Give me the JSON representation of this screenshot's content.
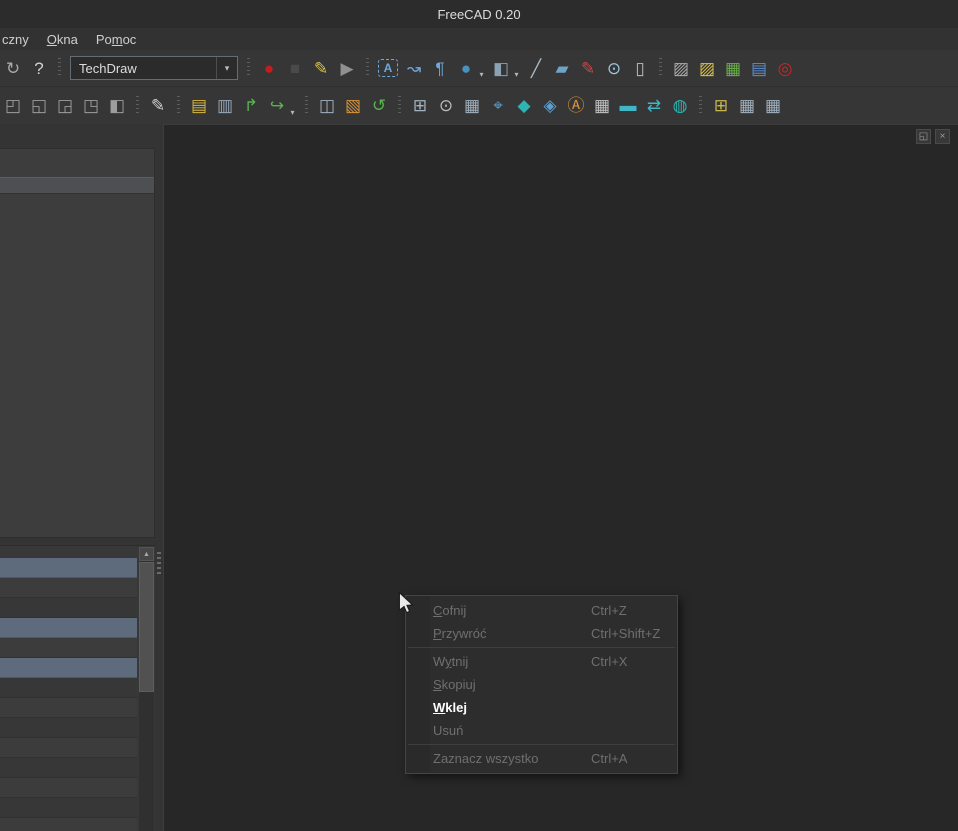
{
  "window": {
    "title": "FreeCAD 0.20"
  },
  "menubar": {
    "items": [
      {
        "pre": "czny",
        "mn": "",
        "post": ""
      },
      {
        "pre": "",
        "mn": "O",
        "post": "kna"
      },
      {
        "pre": "Po",
        "mn": "m",
        "post": "oc"
      }
    ]
  },
  "workbench": {
    "value": "TechDraw",
    "caret": "▾"
  },
  "toolbar1": {
    "nav": [
      {
        "name": "refresh",
        "glyph": "↻",
        "color": "#a9a9a9"
      },
      {
        "name": "whats-this",
        "glyph": "?",
        "color": "#d2d2d2"
      }
    ],
    "macro": [
      {
        "name": "macro-record",
        "glyph": "●",
        "color": "#c41d1d"
      },
      {
        "name": "macro-stop",
        "glyph": "■",
        "color": "#4a4a4a"
      },
      {
        "name": "macro-edit",
        "glyph": "✎",
        "color": "#d9c14d"
      },
      {
        "name": "macro-execute",
        "glyph": "▶",
        "color": "#909090"
      }
    ],
    "annotation": [
      {
        "name": "annotation",
        "glyph": "A",
        "color": "#6fa8dc"
      },
      {
        "name": "leader-line",
        "glyph": "↝",
        "color": "#6fa8dc"
      },
      {
        "name": "rich-text",
        "glyph": "¶",
        "color": "#6fa8dc"
      },
      {
        "name": "center-line",
        "glyph": "●",
        "color": "#4a90c2",
        "caret": "▾"
      },
      {
        "name": "cosmetic-object",
        "glyph": "◧",
        "color": "#8ba1b5",
        "caret": "▾"
      },
      {
        "name": "line-decor",
        "glyph": "╱",
        "color": "#a9bcc9"
      },
      {
        "name": "eraser",
        "glyph": "▰",
        "color": "#6fa3c7"
      },
      {
        "name": "red-pen",
        "glyph": "✎",
        "color": "#c94848"
      },
      {
        "name": "visibility-eye",
        "glyph": "⊙",
        "color": "#9ec7e0"
      },
      {
        "name": "column",
        "glyph": "▯",
        "color": "#bdbdbd"
      }
    ],
    "hatch": [
      {
        "name": "hatch-face",
        "glyph": "▨",
        "color": "#ababab"
      },
      {
        "name": "geometric-hatch",
        "glyph": "▨",
        "color": "#d9c14d"
      },
      {
        "name": "insert-symbol",
        "glyph": "▦",
        "color": "#6ab04c"
      },
      {
        "name": "insert-image",
        "glyph": "▤",
        "color": "#5a8fd0"
      },
      {
        "name": "toggle-frames",
        "glyph": "◎",
        "color": "#cc2424"
      }
    ]
  },
  "toolbar2": {
    "views": [
      {
        "name": "view-cube-1",
        "glyph": "◰",
        "color": "#9d9d9d"
      },
      {
        "name": "view-cube-2",
        "glyph": "◱",
        "color": "#9d9d9d"
      },
      {
        "name": "view-cube-3",
        "glyph": "◲",
        "color": "#9d9d9d"
      },
      {
        "name": "view-cube-4",
        "glyph": "◳",
        "color": "#9d9d9d"
      },
      {
        "name": "view-cube-5",
        "glyph": "◧",
        "color": "#9d9d9d"
      }
    ],
    "stylus": [
      {
        "name": "stylus",
        "glyph": "✎",
        "color": "#cfcfcf"
      }
    ],
    "pages": [
      {
        "name": "new-default-page",
        "glyph": "▤",
        "color": "#d9b83c"
      },
      {
        "name": "new-page-template",
        "glyph": "▥",
        "color": "#95a9bb"
      },
      {
        "name": "redraw-page",
        "glyph": "↱",
        "color": "#57b34f"
      },
      {
        "name": "export-page",
        "glyph": "↪",
        "color": "#57b34f",
        "caret": "▾"
      }
    ],
    "update": [
      {
        "name": "insert-view",
        "glyph": "◫",
        "color": "#a2b2c0"
      },
      {
        "name": "insert-active-view",
        "glyph": "▧",
        "color": "#d9933c"
      },
      {
        "name": "update-views",
        "glyph": "↺",
        "color": "#57b34f"
      }
    ],
    "techdraw_views": [
      {
        "name": "projection-group",
        "glyph": "⊞",
        "color": "#a2b2c0"
      },
      {
        "name": "camera-snapshot",
        "glyph": "⊙",
        "color": "#bdbdbd"
      },
      {
        "name": "section-view",
        "glyph": "▦",
        "color": "#a2b2c0"
      },
      {
        "name": "detail-view",
        "glyph": "⌖",
        "color": "#5a9fd0"
      },
      {
        "name": "3d-view",
        "glyph": "◆",
        "color": "#2fb3b3"
      },
      {
        "name": "clip-group",
        "glyph": "◈",
        "color": "#5a9fd0"
      },
      {
        "name": "draft-view",
        "glyph": "Ⓐ",
        "color": "#d9933c"
      },
      {
        "name": "spreadsheet-view",
        "glyph": "▦",
        "color": "#c3c3c3"
      },
      {
        "name": "arch-view",
        "glyph": "▬",
        "color": "#3fb7c7"
      },
      {
        "name": "arch-section",
        "glyph": "⇄",
        "color": "#3fb7c7"
      },
      {
        "name": "balloon",
        "glyph": "◍",
        "color": "#2fb3b3"
      }
    ],
    "extra": [
      {
        "name": "new-diagram",
        "glyph": "⊞",
        "color": "#c9b94d"
      },
      {
        "name": "table-a",
        "glyph": "▦",
        "color": "#a2b2c0"
      },
      {
        "name": "table-b",
        "glyph": "▦",
        "color": "#a2b2c0"
      }
    ]
  },
  "left_dock": {
    "float_icon": "◱",
    "close_icon": "×",
    "scroll_up_icon": "▲"
  },
  "context_menu": {
    "items": [
      {
        "pre": "",
        "mn": "C",
        "post": "ofnij",
        "shortcut": "Ctrl+Z",
        "enabled": false
      },
      {
        "pre": "",
        "mn": "P",
        "post": "rzywróć",
        "shortcut": "Ctrl+Shift+Z",
        "enabled": false
      },
      {
        "pre": "W",
        "mn": "y",
        "post": "tnij",
        "shortcut": "Ctrl+X",
        "enabled": false
      },
      {
        "pre": "",
        "mn": "S",
        "post": "kopiuj",
        "shortcut": "",
        "enabled": false
      },
      {
        "pre": "",
        "mn": "W",
        "post": "klej",
        "shortcut": "",
        "enabled": true
      },
      {
        "pre": "Usuń",
        "mn": "",
        "post": "",
        "shortcut": "",
        "enabled": false
      },
      {
        "pre": "Zaznacz wszystko",
        "mn": "",
        "post": "",
        "shortcut": "Ctrl+A",
        "enabled": false
      }
    ]
  },
  "colors": {
    "titlebar": "#2c2c2c",
    "toolbar": "#363636",
    "mdi_background": "#272727",
    "panel": "#3d3d3d",
    "row_highlight": "#5d6b7d",
    "menu_background": "#2d2d2d",
    "disabled_text": "#6f6f6f",
    "enabled_text": "#ffffff"
  }
}
